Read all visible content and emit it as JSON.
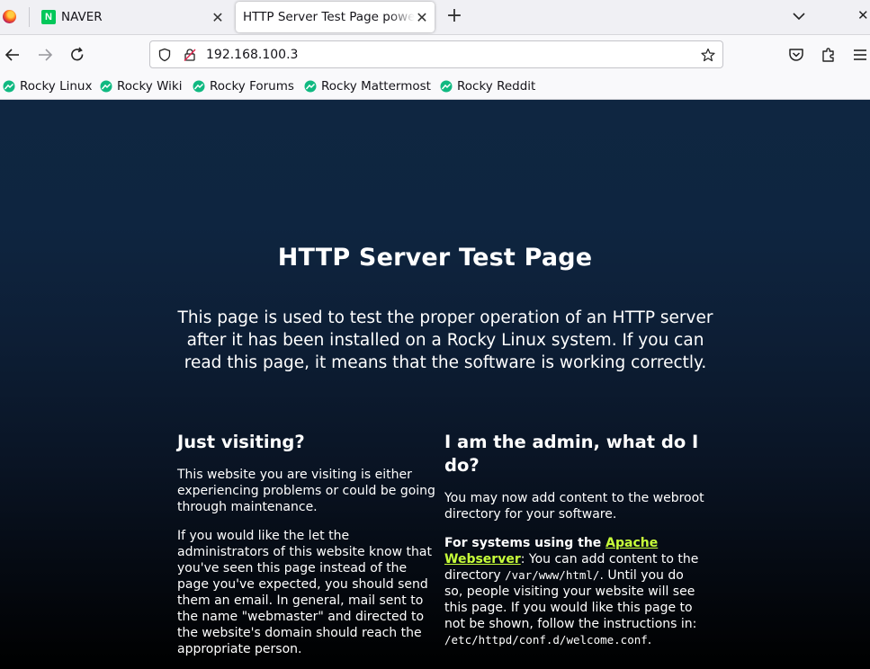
{
  "browser": {
    "tabs": [
      {
        "label": "NAVER",
        "favicon_letter": "N"
      },
      {
        "label": "HTTP Server Test Page powered by"
      }
    ],
    "url": "192.168.100.3",
    "bookmarks": [
      "Rocky Linux",
      "Rocky Wiki",
      "Rocky Forums",
      "Rocky Mattermost",
      "Rocky Reddit"
    ],
    "colors": {
      "naver_green": "#03c75a",
      "rocky_green": "#10b981"
    }
  },
  "page": {
    "title_part1": "HTTP Server",
    "title_part2": "Test Page",
    "intro": "This page is used to test the proper operation of an HTTP server after it has been installed on a Rocky Linux system. If you can read this page, it means that the software is working correctly.",
    "left": {
      "heading": "Just visiting?",
      "p1": "This website you are visiting is either experiencing problems or could be going through maintenance.",
      "p2": "If you would like the let the administrators of this website know that you've seen this page instead of the page you've expected, you should send them an email. In general, mail sent to the name \"webmaster\" and directed to the website's domain should reach the appropriate person."
    },
    "right": {
      "heading": "I am the admin, what do I do?",
      "p1": "You may now add content to the webroot directory for your software.",
      "p2_bold": "For systems using the ",
      "p2_link": "Apache Webserver",
      "p2_a": ": You can add content to the directory ",
      "p2_code1": "/var/www/html/",
      "p2_b": ". Until you do so, people visiting your website will see this page. If you would like this page to not be shown, follow the instructions in: ",
      "p2_code2": "/etc/httpd/conf.d/welcome.conf",
      "p2_end": "."
    },
    "colors": {
      "link": "#c8ff3a",
      "bg_top": "#0f2641",
      "bg_bottom": "#000000"
    }
  }
}
